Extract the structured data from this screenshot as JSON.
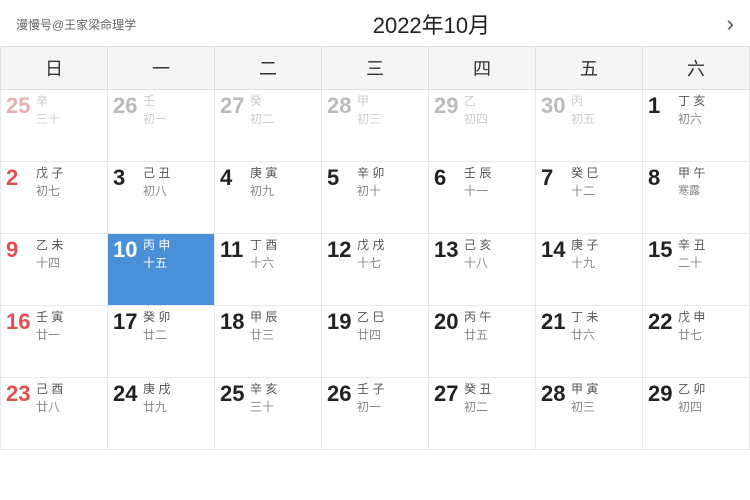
{
  "header": {
    "logo": "漫慢号@王家梁命理学",
    "title": "2022年10月",
    "nav_next": "›"
  },
  "weekdays": [
    "日",
    "一",
    "二",
    "三",
    "四",
    "五",
    "六"
  ],
  "weeks": [
    [
      {
        "day": "25",
        "heavenly": "辛",
        "lunar": "三十",
        "otherMonth": true,
        "solarTerm": ""
      },
      {
        "day": "26",
        "heavenly": "壬",
        "lunar": "初一",
        "otherMonth": true,
        "solarTerm": ""
      },
      {
        "day": "27",
        "heavenly": "癸",
        "lunar": "初二",
        "otherMonth": true,
        "solarTerm": ""
      },
      {
        "day": "28",
        "heavenly": "甲",
        "lunar": "初三",
        "otherMonth": true,
        "solarTerm": ""
      },
      {
        "day": "29",
        "heavenly": "乙",
        "lunar": "初四",
        "otherMonth": true,
        "solarTerm": ""
      },
      {
        "day": "30",
        "heavenly": "丙",
        "lunar": "初五",
        "otherMonth": true,
        "solarTerm": ""
      },
      {
        "day": "1",
        "heavenly": "丁",
        "lunar": "初六",
        "otherMonth": false,
        "solarTerm": "",
        "heavenly2": "亥"
      }
    ],
    [
      {
        "day": "2",
        "heavenly": "戊",
        "lunar": "初七",
        "otherMonth": false,
        "solarTerm": "",
        "heavenly2": "子"
      },
      {
        "day": "3",
        "heavenly": "己",
        "lunar": "初八",
        "otherMonth": false,
        "solarTerm": "",
        "heavenly2": "丑"
      },
      {
        "day": "4",
        "heavenly": "庚",
        "lunar": "初九",
        "otherMonth": false,
        "solarTerm": "",
        "heavenly2": "寅"
      },
      {
        "day": "5",
        "heavenly": "辛",
        "lunar": "初十",
        "otherMonth": false,
        "solarTerm": "",
        "heavenly2": "卯"
      },
      {
        "day": "6",
        "heavenly": "壬",
        "lunar": "十一",
        "otherMonth": false,
        "solarTerm": "",
        "heavenly2": "辰"
      },
      {
        "day": "7",
        "heavenly": "癸",
        "lunar": "十二",
        "otherMonth": false,
        "solarTerm": "",
        "heavenly2": "巳"
      },
      {
        "day": "8",
        "heavenly": "甲",
        "lunar": "寒露",
        "otherMonth": false,
        "solarTerm": "寒露",
        "heavenly2": "午"
      }
    ],
    [
      {
        "day": "9",
        "heavenly": "乙",
        "lunar": "十四",
        "otherMonth": false,
        "solarTerm": "",
        "heavenly2": "未"
      },
      {
        "day": "10",
        "heavenly": "丙",
        "lunar": "十五",
        "otherMonth": false,
        "selected": true,
        "solarTerm": "",
        "heavenly2": "申"
      },
      {
        "day": "11",
        "heavenly": "丁",
        "lunar": "十六",
        "otherMonth": false,
        "solarTerm": "",
        "heavenly2": "酉"
      },
      {
        "day": "12",
        "heavenly": "戊",
        "lunar": "十七",
        "otherMonth": false,
        "solarTerm": "",
        "heavenly2": "戌"
      },
      {
        "day": "13",
        "heavenly": "己",
        "lunar": "十八",
        "otherMonth": false,
        "solarTerm": "",
        "heavenly2": "亥"
      },
      {
        "day": "14",
        "heavenly": "庚",
        "lunar": "十九",
        "otherMonth": false,
        "solarTerm": "",
        "heavenly2": "子"
      },
      {
        "day": "15",
        "heavenly": "辛",
        "lunar": "二十",
        "otherMonth": false,
        "solarTerm": "",
        "heavenly2": "丑"
      }
    ],
    [
      {
        "day": "16",
        "heavenly": "壬",
        "lunar": "廿一",
        "otherMonth": false,
        "solarTerm": "",
        "heavenly2": "寅"
      },
      {
        "day": "17",
        "heavenly": "癸",
        "lunar": "廿二",
        "otherMonth": false,
        "solarTerm": "",
        "heavenly2": "卯"
      },
      {
        "day": "18",
        "heavenly": "甲",
        "lunar": "廿三",
        "otherMonth": false,
        "solarTerm": "",
        "heavenly2": "辰"
      },
      {
        "day": "19",
        "heavenly": "乙",
        "lunar": "廿四",
        "otherMonth": false,
        "solarTerm": "",
        "heavenly2": "巳"
      },
      {
        "day": "20",
        "heavenly": "丙",
        "lunar": "廿五",
        "otherMonth": false,
        "solarTerm": "",
        "heavenly2": "午"
      },
      {
        "day": "21",
        "heavenly": "丁",
        "lunar": "廿六",
        "otherMonth": false,
        "solarTerm": "",
        "heavenly2": "未"
      },
      {
        "day": "22",
        "heavenly": "戊",
        "lunar": "廿七",
        "otherMonth": false,
        "solarTerm": "",
        "heavenly2": "申"
      }
    ],
    [
      {
        "day": "23",
        "heavenly": "己",
        "lunar": "廿八",
        "otherMonth": false,
        "solarTerm": "",
        "heavenly2": "酉"
      },
      {
        "day": "24",
        "heavenly": "庚",
        "lunar": "廿九",
        "otherMonth": false,
        "solarTerm": "",
        "heavenly2": "戌"
      },
      {
        "day": "25",
        "heavenly": "辛",
        "lunar": "三十",
        "otherMonth": false,
        "solarTerm": "",
        "heavenly2": "亥"
      },
      {
        "day": "26",
        "heavenly": "壬",
        "lunar": "初一",
        "otherMonth": false,
        "solarTerm": "",
        "heavenly2": "子"
      },
      {
        "day": "27",
        "heavenly": "癸",
        "lunar": "初二",
        "otherMonth": false,
        "solarTerm": "",
        "heavenly2": "丑"
      },
      {
        "day": "28",
        "heavenly": "甲",
        "lunar": "初三",
        "otherMonth": false,
        "solarTerm": "",
        "heavenly2": "寅"
      },
      {
        "day": "29",
        "heavenly": "乙",
        "lunar": "初四",
        "otherMonth": false,
        "solarTerm": "",
        "heavenly2": "卯"
      }
    ]
  ]
}
